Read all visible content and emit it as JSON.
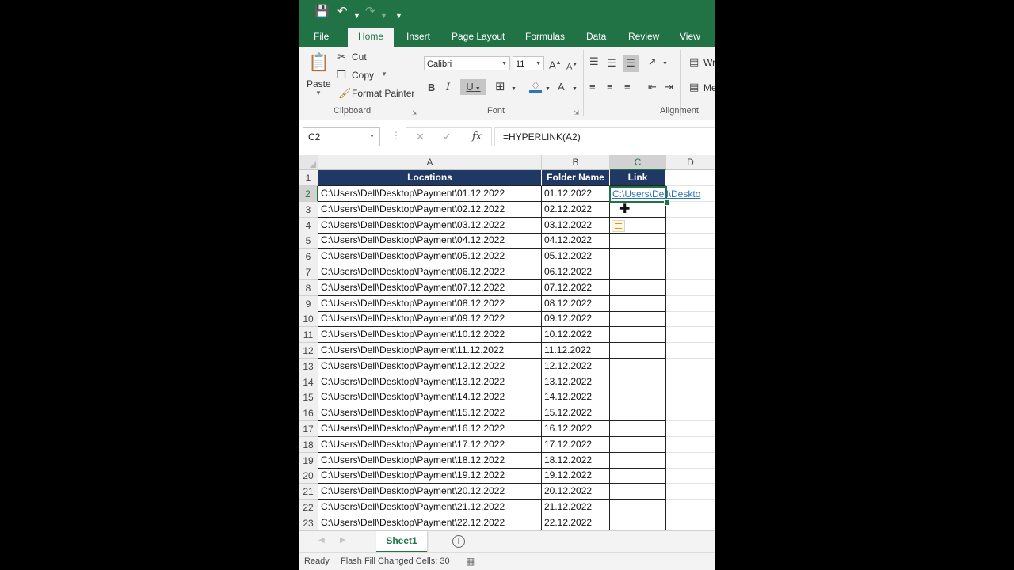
{
  "colors": {
    "excel_green": "#217346",
    "header_fill": "#1f3864",
    "link": "#2e75b6"
  },
  "quick_access": {
    "save_icon": "save-icon",
    "undo_icon": "undo-icon",
    "redo_icon": "redo-icon",
    "customize_icon": "customize-icon"
  },
  "tabs": [
    {
      "label": "File"
    },
    {
      "label": "Home"
    },
    {
      "label": "Insert"
    },
    {
      "label": "Page Layout"
    },
    {
      "label": "Formulas"
    },
    {
      "label": "Data"
    },
    {
      "label": "Review"
    },
    {
      "label": "View"
    }
  ],
  "ribbon": {
    "clipboard": {
      "paste": "Paste",
      "cut": "Cut",
      "copy": "Copy",
      "format_painter": "Format Painter",
      "group_label": "Clipboard"
    },
    "font": {
      "family": "Calibri",
      "size": "11",
      "bold": "B",
      "italic": "I",
      "underline": "U",
      "grow": "A",
      "shrink": "A",
      "font_color": "A",
      "group_label": "Font"
    },
    "alignment": {
      "wrap": "Wr",
      "merge": "Me",
      "group_label": "Alignment"
    }
  },
  "formula_bar": {
    "name_box": "C2",
    "fx": "fx",
    "formula": "=HYPERLINK(A2)"
  },
  "columns": [
    {
      "label": ""
    },
    {
      "label": "A"
    },
    {
      "label": "B"
    },
    {
      "label": "C"
    },
    {
      "label": "D"
    }
  ],
  "table": {
    "headers": [
      "Locations",
      "Folder Name",
      "Link"
    ],
    "rows": [
      {
        "n": "2",
        "location": "C:\\Users\\Dell\\Desktop\\Payment\\01.12.2022",
        "folder": "01.12.2022",
        "link": "C:\\Users\\Dell\\Deskto"
      },
      {
        "n": "3",
        "location": "C:\\Users\\Dell\\Desktop\\Payment\\02.12.2022",
        "folder": "02.12.2022",
        "link": ""
      },
      {
        "n": "4",
        "location": "C:\\Users\\Dell\\Desktop\\Payment\\03.12.2022",
        "folder": "03.12.2022",
        "link": ""
      },
      {
        "n": "5",
        "location": "C:\\Users\\Dell\\Desktop\\Payment\\04.12.2022",
        "folder": "04.12.2022",
        "link": ""
      },
      {
        "n": "6",
        "location": "C:\\Users\\Dell\\Desktop\\Payment\\05.12.2022",
        "folder": "05.12.2022",
        "link": ""
      },
      {
        "n": "7",
        "location": "C:\\Users\\Dell\\Desktop\\Payment\\06.12.2022",
        "folder": "06.12.2022",
        "link": ""
      },
      {
        "n": "8",
        "location": "C:\\Users\\Dell\\Desktop\\Payment\\07.12.2022",
        "folder": "07.12.2022",
        "link": ""
      },
      {
        "n": "9",
        "location": "C:\\Users\\Dell\\Desktop\\Payment\\08.12.2022",
        "folder": "08.12.2022",
        "link": ""
      },
      {
        "n": "10",
        "location": "C:\\Users\\Dell\\Desktop\\Payment\\09.12.2022",
        "folder": "09.12.2022",
        "link": ""
      },
      {
        "n": "11",
        "location": "C:\\Users\\Dell\\Desktop\\Payment\\10.12.2022",
        "folder": "10.12.2022",
        "link": ""
      },
      {
        "n": "12",
        "location": "C:\\Users\\Dell\\Desktop\\Payment\\11.12.2022",
        "folder": "11.12.2022",
        "link": ""
      },
      {
        "n": "13",
        "location": "C:\\Users\\Dell\\Desktop\\Payment\\12.12.2022",
        "folder": "12.12.2022",
        "link": ""
      },
      {
        "n": "14",
        "location": "C:\\Users\\Dell\\Desktop\\Payment\\13.12.2022",
        "folder": "13.12.2022",
        "link": ""
      },
      {
        "n": "15",
        "location": "C:\\Users\\Dell\\Desktop\\Payment\\14.12.2022",
        "folder": "14.12.2022",
        "link": ""
      },
      {
        "n": "16",
        "location": "C:\\Users\\Dell\\Desktop\\Payment\\15.12.2022",
        "folder": "15.12.2022",
        "link": ""
      },
      {
        "n": "17",
        "location": "C:\\Users\\Dell\\Desktop\\Payment\\16.12.2022",
        "folder": "16.12.2022",
        "link": ""
      },
      {
        "n": "18",
        "location": "C:\\Users\\Dell\\Desktop\\Payment\\17.12.2022",
        "folder": "17.12.2022",
        "link": ""
      },
      {
        "n": "19",
        "location": "C:\\Users\\Dell\\Desktop\\Payment\\18.12.2022",
        "folder": "18.12.2022",
        "link": ""
      },
      {
        "n": "20",
        "location": "C:\\Users\\Dell\\Desktop\\Payment\\19.12.2022",
        "folder": "19.12.2022",
        "link": ""
      },
      {
        "n": "21",
        "location": "C:\\Users\\Dell\\Desktop\\Payment\\20.12.2022",
        "folder": "20.12.2022",
        "link": ""
      },
      {
        "n": "22",
        "location": "C:\\Users\\Dell\\Desktop\\Payment\\21.12.2022",
        "folder": "21.12.2022",
        "link": ""
      },
      {
        "n": "23",
        "location": "C:\\Users\\Dell\\Desktop\\Payment\\22.12.2022",
        "folder": "22.12.2022",
        "link": ""
      }
    ]
  },
  "sheet_tabs": [
    {
      "label": "Sheet1"
    }
  ],
  "status": {
    "ready": "Ready",
    "message": "Flash Fill Changed Cells: 30"
  }
}
